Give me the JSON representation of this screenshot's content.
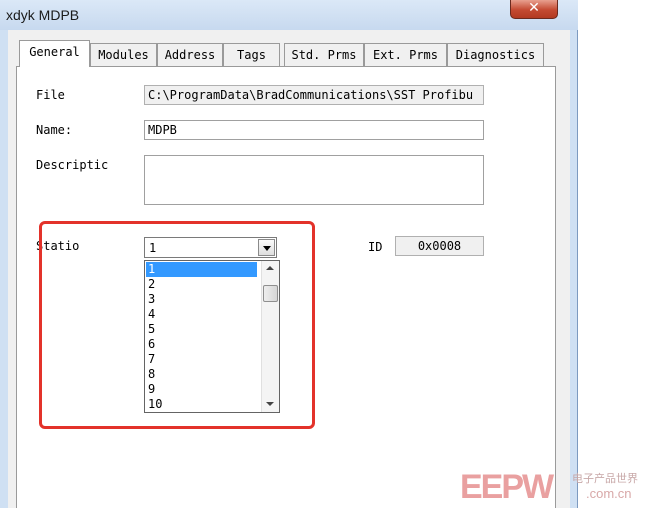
{
  "window": {
    "title": "xdyk MDPB",
    "close_glyph": "✕"
  },
  "tabs": [
    {
      "label": "General",
      "active": true
    },
    {
      "label": "Modules",
      "active": false
    },
    {
      "label": "Address",
      "active": false
    },
    {
      "label": "Tags",
      "active": false
    },
    {
      "label": "Std. Prms",
      "active": false
    },
    {
      "label": "Ext. Prms",
      "active": false
    },
    {
      "label": "Diagnostics",
      "active": false
    }
  ],
  "general": {
    "file_label": "File",
    "file_value": "C:\\ProgramData\\BradCommunications\\SST Profibu",
    "name_label": "Name:",
    "name_value": "MDPB",
    "description_label": "Descriptic",
    "description_value": "",
    "station_label": "Statio",
    "station_value": "1",
    "id_label": "ID",
    "id_value": "0x0008"
  },
  "station_options": [
    "1",
    "2",
    "3",
    "4",
    "5",
    "6",
    "7",
    "8",
    "9",
    "10"
  ],
  "station_selected_index": 0,
  "watermark": {
    "logo": "EEPW",
    "tagline": "电子产品世界",
    "url": ".com.cn"
  },
  "colors": {
    "highlight": "#e3322a",
    "selection": "#3399ff",
    "close_button": "#c44a32"
  },
  "icons": {
    "dropdown": "chevron-down-icon",
    "scroll_up": "scroll-up-arrow-icon",
    "scroll_down": "scroll-down-arrow-icon",
    "close": "close-icon"
  }
}
